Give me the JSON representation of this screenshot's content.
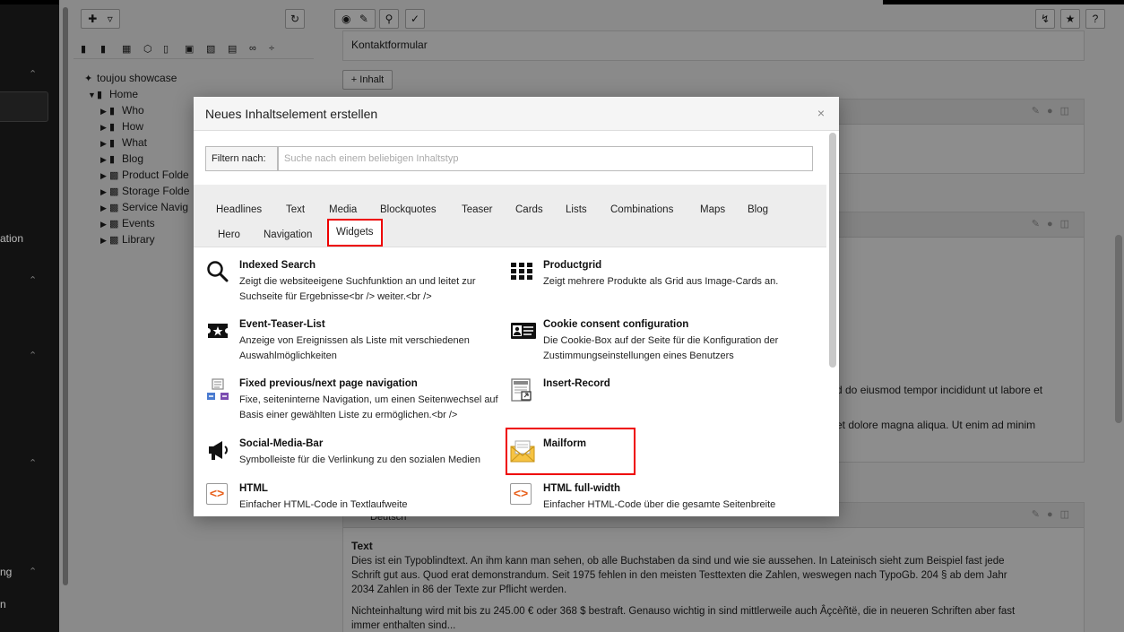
{
  "module_menu": {
    "labels": [
      "ation",
      "ng",
      "n"
    ]
  },
  "page_tree": {
    "nodes": [
      {
        "label": "toujou showcase",
        "icon": "typo3-logo-icon"
      },
      {
        "label": "Home",
        "icon": "page-icon"
      },
      {
        "label": "Who",
        "icon": "page-icon"
      },
      {
        "label": "How",
        "icon": "page-icon"
      },
      {
        "label": "What",
        "icon": "page-icon"
      },
      {
        "label": "Blog",
        "icon": "page-icon"
      },
      {
        "label": "Product Folde",
        "icon": "folder-icon"
      },
      {
        "label": "Storage Folde",
        "icon": "folder-icon"
      },
      {
        "label": "Service Navig",
        "icon": "folder-icon"
      },
      {
        "label": "Events",
        "icon": "folder-icon"
      },
      {
        "label": "Library",
        "icon": "folder-icon"
      }
    ]
  },
  "content_area": {
    "kontakt_label": "Kontaktformular",
    "add_content_label": "Inhalt",
    "lang_label": "Deutsch",
    "lorem_1": "d do eiusmod tempor incididunt ut labore et",
    "lorem_2": "et dolore magna aliqua. Ut enim ad minim",
    "text_heading": "Text",
    "text_p1_l1": "Dies ist ein Typoblindtext. An ihm kann man sehen, ob alle Buchstaben da sind und wie sie aussehen. In Lateinisch sieht zum Beispiel fast jede",
    "text_p1_l2": "Schrift gut aus. Quod erat demonstrandum. Seit 1975 fehlen in den meisten Testtexten die Zahlen, weswegen nach TypoGb. 204 § ab dem Jahr",
    "text_p1_l3": "2034 Zahlen in 86 der Texte zur Pflicht werden.",
    "text_p2_l1": "Nichteinhaltung wird mit bis zu 245.00 € oder 368 $ bestraft. Genauso wichtig in sind mittlerweile auch Âçcèñtë, die in neueren Schriften aber fast",
    "text_p2_l2": "immer enthalten sind..."
  },
  "modal": {
    "title": "Neues Inhaltselement erstellen",
    "close_label": "×",
    "filter_label": "Filtern nach:",
    "filter_placeholder": "Suche nach einem beliebigen Inhaltstyp",
    "filter_value": "",
    "tabs": [
      "Headlines",
      "Text",
      "Media",
      "Blockquotes",
      "Teaser",
      "Cards",
      "Lists",
      "Combinations",
      "Maps",
      "Blog",
      "Hero",
      "Navigation",
      "Widgets"
    ],
    "active_tab": "Widgets",
    "items": [
      {
        "title": "Indexed Search",
        "desc": "Zeigt die websiteeigene Suchfunktion an und leitet zur Suchseite für Ergebnisse<br /> weiter.<br />",
        "icon": "search-icon"
      },
      {
        "title": "Productgrid",
        "desc": "Zeigt mehrere Produkte als Grid aus Image-Cards an.",
        "icon": "grid-icon"
      },
      {
        "title": "Event-Teaser-List",
        "desc": "Anzeige von Ereignissen als Liste mit verschiedenen Auswahlmöglichkeiten",
        "icon": "ticket-star-icon"
      },
      {
        "title": "Cookie consent configuration",
        "desc": "Die Cookie-Box auf der Seite für die Konfiguration der Zustimmungseinstellungen eines Benutzers",
        "icon": "id-card-icon"
      },
      {
        "title": "Fixed previous/next page navigation",
        "desc": "Fixe, seiteninterne Navigation, um einen Seitenwechsel auf Basis einer gewählten Liste zu ermöglichen.<br />",
        "icon": "page-nav-icon"
      },
      {
        "title": "Insert-Record",
        "desc": "",
        "icon": "insert-record-icon"
      },
      {
        "title": "Social-Media-Bar",
        "desc": "Symbolleiste für die Verlinkung zu den sozialen Medien",
        "icon": "megaphone-icon"
      },
      {
        "title": "Mailform",
        "desc": "",
        "icon": "mail-envelope-icon"
      },
      {
        "title": "HTML",
        "desc": "Einfacher HTML-Code in Textlaufweite",
        "icon": "html-code-icon"
      },
      {
        "title": "HTML full-width",
        "desc": "Einfacher HTML-Code über die gesamte Seitenbreite",
        "icon": "html-code-icon"
      }
    ]
  },
  "colors": {
    "highlight": "#ee0000",
    "dim_overlay": "#8a8a8a",
    "module_menu_bg": "#121212"
  }
}
